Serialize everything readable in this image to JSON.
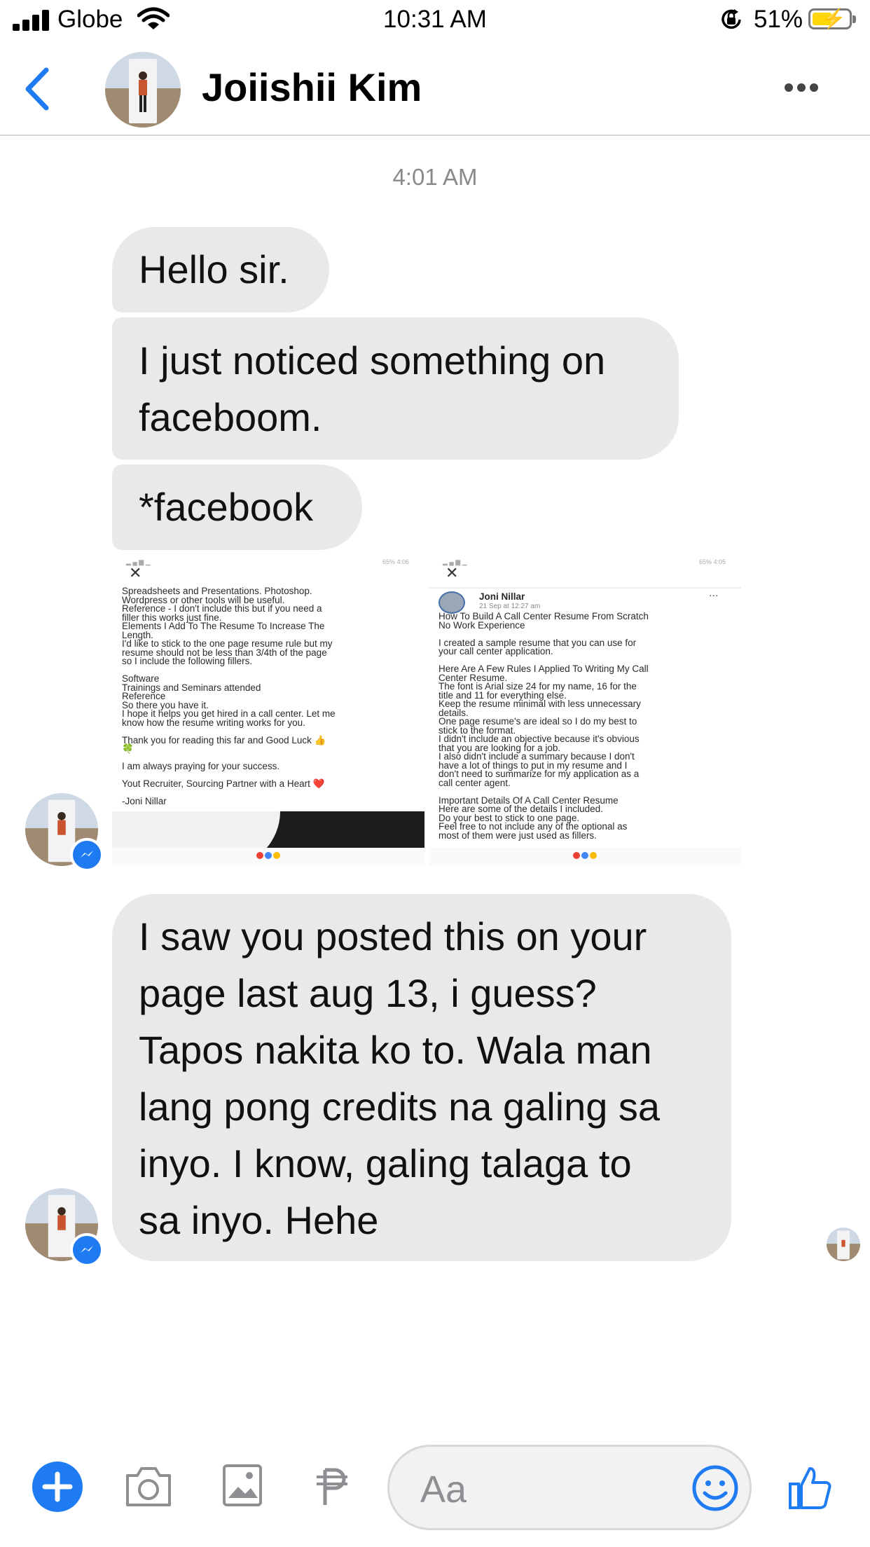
{
  "status_bar": {
    "carrier": "Globe",
    "time": "10:31 AM",
    "battery_percent": "51%"
  },
  "header": {
    "contact_name": "Joiishii Kim"
  },
  "conversation": {
    "timestamp": "4:01 AM",
    "messages": [
      {
        "lines": [
          "Hello sir."
        ]
      },
      {
        "lines": [
          "I just noticed something on",
          "faceboom."
        ]
      },
      {
        "lines": [
          "*facebook"
        ]
      },
      {
        "lines": [
          "I saw you posted this on your",
          "page last aug 13, i guess?",
          "Tapos nakita ko to. Wala man",
          "lang pong credits na galing sa",
          "inyo. I know, galing talaga to",
          "sa inyo. Hehe"
        ]
      }
    ],
    "attachment_left": {
      "status": "65%  4:06",
      "lines": [
        "Spreadsheets and Presentations. Photoshop.",
        "Wordpress or other tools will be useful.",
        "Reference - I don't include this but if you need a",
        "filler this works just fine.",
        "Elements I Add To The Resume To Increase The",
        "Length.",
        "I'd like to stick to the one page resume rule but my",
        "resume should not be less than 3/4th of the page",
        "so I include the following fillers.",
        "",
        "Software",
        "Trainings and Seminars attended",
        "Reference",
        "So there you have it.",
        "I hope it helps you get hired in a call center. Let me",
        "know how the resume writing works for you.",
        "",
        "Thank you for reading this far and Good Luck 👍",
        "🍀",
        "",
        "I am always praying for your success.",
        "",
        "Yout Recruiter, Sourcing Partner with a Heart ❤️",
        "",
        "-Joni Nillar"
      ]
    },
    "attachment_right": {
      "status": "65%  4:05",
      "author": "Joni Nillar",
      "post_meta": "21 Sep at 12:27 am",
      "menu": "···",
      "lines": [
        "How To Build A Call Center Resume From Scratch",
        "No Work Experience",
        "",
        "I created a sample resume that you can use for",
        "your call center application.",
        "",
        "Here Are A Few Rules I Applied To Writing My Call",
        "Center Resume.",
        "The font is Arial size 24 for my name, 16 for the",
        "title and 11 for everything else.",
        "Keep the resume minimal with less unnecessary",
        "details.",
        "One page resume's are ideal so I do my best to",
        "stick to the format.",
        "I didn't include an objective because it's obvious",
        "that you are looking for a job.",
        "I also didn't include a summary because I don't",
        "have a lot of things to put in my resume and I",
        "don't need to summarize for my application as a",
        "call center agent.",
        "",
        "Important Details Of A Call Center Resume",
        "Here are some of the details I included.",
        "Do your best to stick to one page.",
        "Feel free to not include any of the optional as",
        "most of them were just used as fillers."
      ]
    }
  },
  "composer": {
    "placeholder": "Aa"
  },
  "icons": [
    "signal-icon",
    "wifi-icon",
    "orientation-lock-icon",
    "battery-icon",
    "back-chevron-icon",
    "more-dots-icon",
    "plus-icon",
    "camera-icon",
    "gallery-icon",
    "payment-icon",
    "emoji-icon",
    "thumbs-up-icon"
  ],
  "colors": {
    "accent": "#1e7bf2",
    "bubble": "#e9e9eb",
    "battery": "#ffd60a"
  }
}
